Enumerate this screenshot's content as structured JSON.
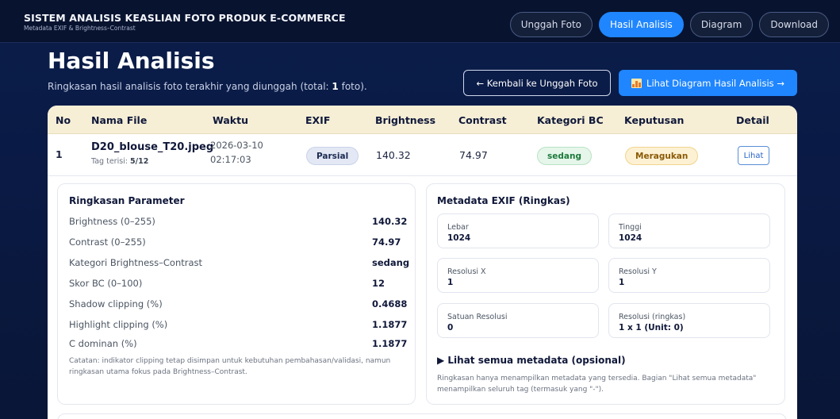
{
  "app": {
    "title": "SISTEM ANALISIS KEASLIAN FOTO PRODUK E-COMMERCE",
    "subtitle": "Metadata EXIF & Brightness–Contrast"
  },
  "nav": {
    "items": [
      {
        "label": "Unggah Foto",
        "active": false
      },
      {
        "label": "Hasil Analisis",
        "active": true
      },
      {
        "label": "Diagram",
        "active": false
      },
      {
        "label": "Download",
        "active": false
      }
    ]
  },
  "header": {
    "title": "Hasil Analisis",
    "subtitle_prefix": "Ringkasan hasil analisis foto terakhir yang diunggah (total: ",
    "total": "1",
    "subtitle_suffix": " foto).",
    "back_button": "← Kembali ke Unggah Foto",
    "diagram_button": "Lihat Diagram Hasil Analisis →",
    "diagram_icon": "bar-chart-icon"
  },
  "table": {
    "columns": [
      "No",
      "Nama File",
      "Waktu",
      "EXIF",
      "Brightness",
      "Contrast",
      "Kategori BC",
      "Keputusan",
      "Detail"
    ],
    "rows": [
      {
        "no": "1",
        "file_name": "D20_blouse_T20.jpeg",
        "tag_label": "Tag terisi: ",
        "tag_value": "5/12",
        "date": "2026-03-10",
        "time": "02:17:03",
        "exif": "Parsial",
        "brightness": "140.32",
        "contrast": "74.97",
        "kategori": "sedang",
        "keputusan": "Meragukan",
        "detail": "Lihat"
      }
    ]
  },
  "parameters": {
    "title": "Ringkasan Parameter",
    "items": [
      {
        "label": "Brightness (0–255)",
        "value": "140.32"
      },
      {
        "label": "Contrast (0–255)",
        "value": "74.97"
      },
      {
        "label": "Kategori Brightness–Contrast",
        "value": "sedang"
      },
      {
        "label": "Skor BC (0–100)",
        "value": "12"
      },
      {
        "label": "Shadow clipping (%)",
        "value": "0.4688"
      },
      {
        "label": "Highlight clipping (%)",
        "value": "1.1877"
      },
      {
        "label": "C dominan (%)",
        "value": "1.1877"
      }
    ],
    "note": "Catatan: indikator clipping tetap disimpan untuk kebutuhan pembahasan/validasi, namun ringkasan utama fokus pada Brightness–Contrast."
  },
  "exif": {
    "title": "Metadata EXIF (Ringkas)",
    "fields": [
      {
        "label": "Lebar",
        "value": "1024"
      },
      {
        "label": "Tinggi",
        "value": "1024"
      },
      {
        "label": "Resolusi X",
        "value": "1"
      },
      {
        "label": "Resolusi Y",
        "value": "1"
      },
      {
        "label": "Satuan Resolusi",
        "value": "0"
      },
      {
        "label": "Resolusi (ringkas)",
        "value": "1 x 1 (Unit: 0)"
      }
    ],
    "more_label": "▶ Lihat semua metadata (opsional)",
    "note": "Ringkasan hanya menampilkan metadata yang tersedia. Bagian \"Lihat semua metadata\" menampilkan seluruh tag (termasuk yang \"-\")."
  },
  "colors": {
    "accent": "#1f86ff",
    "background": "#0b1d4a",
    "header_row": "#f6efd6",
    "success": "#1e7a3c",
    "warning": "#8a5a06"
  }
}
